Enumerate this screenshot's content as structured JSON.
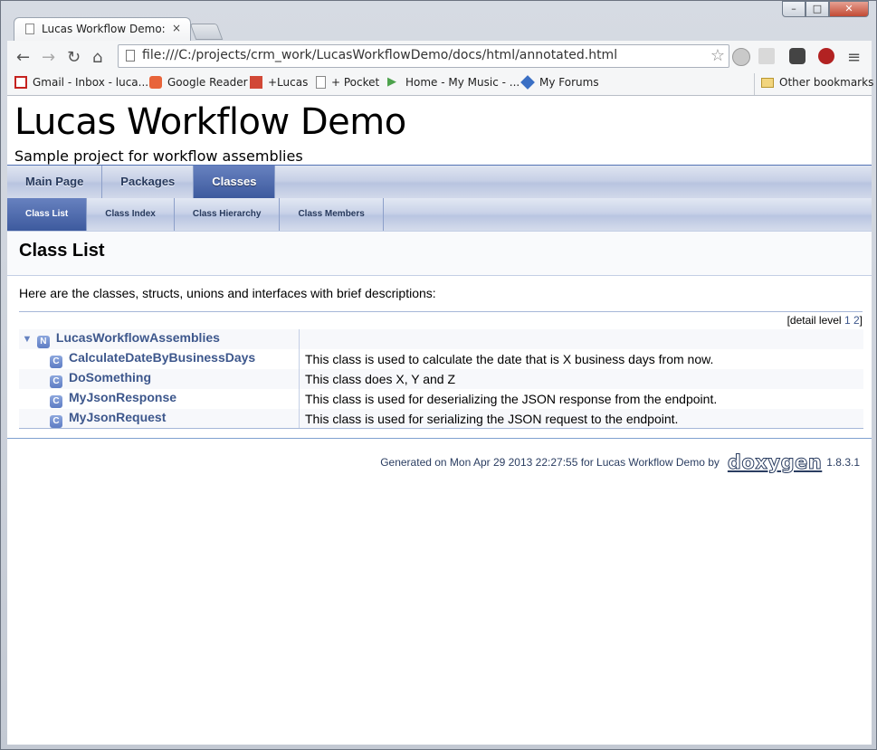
{
  "browser": {
    "tab_title": "Lucas Workflow Demo: Cl",
    "tab_close": "×",
    "url": "file:///C:/projects/crm_work/LucasWorkflowDemo/docs/html/annotated.html",
    "bookmarks": [
      {
        "label": "Gmail - Inbox - luca...",
        "icon": "gmail-icon",
        "color": "#c5221f"
      },
      {
        "label": "Google Reader",
        "icon": "google-reader-icon",
        "color": "#e8643a"
      },
      {
        "label": "+Lucas",
        "icon": "google-plus-icon",
        "color": "#d14836"
      },
      {
        "label": "+ Pocket",
        "icon": "page-icon",
        "color": "#888888"
      },
      {
        "label": "Home - My Music - ...",
        "icon": "play-icon",
        "color": "#4ca24c"
      },
      {
        "label": "My Forums",
        "icon": "forums-icon",
        "color": "#3a6fc4"
      }
    ],
    "other_bookmarks": "Other bookmarks"
  },
  "page": {
    "project_name": "Lucas Workflow Demo",
    "project_brief": "Sample project for workflow assemblies",
    "main_tabs": [
      "Main Page",
      "Packages",
      "Classes"
    ],
    "active_main_tab": "Classes",
    "sub_tabs": [
      "Class List",
      "Class Index",
      "Class Hierarchy",
      "Class Members"
    ],
    "active_sub_tab": "Class List",
    "heading": "Class List",
    "intro": "Here are the classes, structs, unions and interfaces with brief descriptions:",
    "detail_level_prefix": "[detail level ",
    "detail_levels": [
      "1",
      "2"
    ],
    "detail_level_suffix": "]",
    "namespace": {
      "icon": "N",
      "arrow": "▼",
      "name": "LucasWorkflowAssemblies"
    },
    "classes": [
      {
        "icon": "C",
        "name": "CalculateDateByBusinessDays",
        "desc": "This class is used to calculate the date that is X business days from now."
      },
      {
        "icon": "C",
        "name": "DoSomething",
        "desc": "This class does X, Y and Z"
      },
      {
        "icon": "C",
        "name": "MyJsonResponse",
        "desc": "This class is used for deserializing the JSON response from the endpoint."
      },
      {
        "icon": "C",
        "name": "MyJsonRequest",
        "desc": "This class is used for serializing the JSON request to the endpoint."
      }
    ],
    "footer": {
      "generated": "Generated on Mon Apr 29 2013 22:27:55 for Lucas Workflow Demo by",
      "logo": "doxygen",
      "version": "1.8.3.1"
    }
  },
  "colors": {
    "nav_active": "#3d5a9e",
    "link": "#3d578c"
  }
}
